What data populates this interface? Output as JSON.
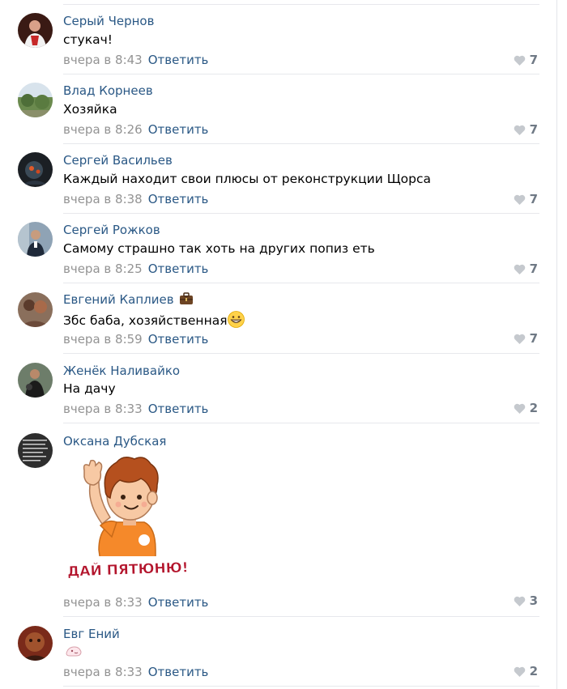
{
  "comments": [
    {
      "author": "Серый Чернов",
      "text": "стукач!",
      "date": "вчера в 8:43",
      "reply": "Ответить",
      "likes": "7"
    },
    {
      "author": "Влад Корнеев",
      "text": "Хозяйка",
      "date": "вчера в 8:26",
      "reply": "Ответить",
      "likes": "7"
    },
    {
      "author": "Сергей Васильев",
      "text": "Каждый находит свои плюсы от реконструкции Щорса",
      "date": "вчера в 8:38",
      "reply": "Ответить",
      "likes": "7"
    },
    {
      "author": "Сергей Рожков",
      "text": "Самому страшно так хоть на других попиз еть",
      "date": "вчера в 8:25",
      "reply": "Ответить",
      "likes": "7"
    },
    {
      "author": "Евгений Каплиев",
      "text": "Збс баба, хозяйственная",
      "date": "вчера в 8:59",
      "reply": "Ответить",
      "likes": "7"
    },
    {
      "author": "Женёк Наливайко",
      "text": "На дачу",
      "date": "вчера в 8:33",
      "reply": "Ответить",
      "likes": "2"
    },
    {
      "author": "Оксана Дубская",
      "sticker_text": "ДАЙ ПЯТЮНЮ!",
      "date": "вчера в 8:33",
      "reply": "Ответить",
      "likes": "3"
    },
    {
      "author": "Евг Ений",
      "date": "вчера в 8:33",
      "reply": "Ответить",
      "likes": "2"
    }
  ],
  "icons": {
    "like": "heart-icon",
    "badge": "briefcase-icon",
    "emoji": "grinning-face-icon"
  },
  "colors": {
    "link": "#2a5885",
    "meta": "#939393",
    "likes": "#6f7985",
    "heart": "#c5c9ce"
  }
}
